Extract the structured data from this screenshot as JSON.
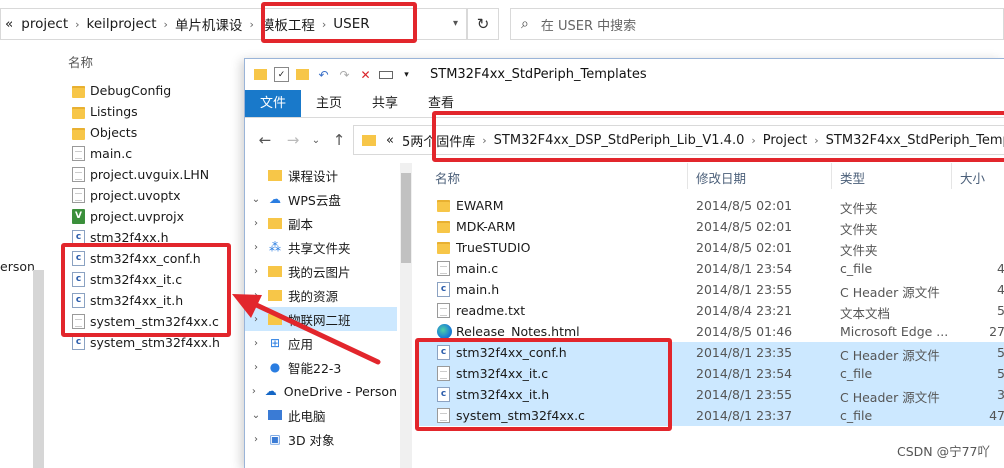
{
  "bg": {
    "address": {
      "prefix": "«",
      "crumbs": [
        "project",
        "keilproject",
        "单片机课设",
        "模板工程",
        "USER"
      ],
      "dropdown_icon": "chevron-down-icon"
    },
    "refresh_icon": "refresh-icon",
    "search": {
      "placeholder": "在 USER 中搜索",
      "icon": "search-icon"
    },
    "left_partial_text": "erson",
    "column_header": "名称",
    "files": [
      {
        "name": "DebugConfig",
        "icon": "folder"
      },
      {
        "name": "Listings",
        "icon": "folder"
      },
      {
        "name": "Objects",
        "icon": "folder"
      },
      {
        "name": "main.c",
        "icon": "file"
      },
      {
        "name": "project.uvguix.LHN",
        "icon": "file"
      },
      {
        "name": "project.uvoptx",
        "icon": "file"
      },
      {
        "name": "project.uvprojx",
        "icon": "uvproj"
      },
      {
        "name": "stm32f4xx.h",
        "icon": "c"
      },
      {
        "name": "stm32f4xx_conf.h",
        "icon": "c"
      },
      {
        "name": "stm32f4xx_it.c",
        "icon": "c"
      },
      {
        "name": "stm32f4xx_it.h",
        "icon": "c"
      },
      {
        "name": "system_stm32f4xx.c",
        "icon": "file"
      },
      {
        "name": "system_stm32f4xx.h",
        "icon": "c"
      }
    ],
    "partial_headers": [
      "修改日期",
      "类型",
      "大小"
    ]
  },
  "fg": {
    "title": "STM32F4xx_StdPeriph_Templates",
    "ribbon_tabs": [
      "文件",
      "主页",
      "共享",
      "查看"
    ],
    "address": {
      "prefix": "«",
      "crumbs": [
        "5两个固件库",
        "STM32F4xx_DSP_StdPeriph_Lib_V1.4.0",
        "Project",
        "STM32F4xx_StdPeriph_Templates"
      ]
    },
    "nav_pane": [
      {
        "label": "课程设计",
        "icon": "folder",
        "arrow": ""
      },
      {
        "label": "WPS云盘",
        "icon": "cloud-icon",
        "arrow": "⌄"
      },
      {
        "label": "副本",
        "icon": "folder",
        "arrow": "›"
      },
      {
        "label": "共享文件夹",
        "icon": "share-icon",
        "arrow": "›"
      },
      {
        "label": "我的云图片",
        "icon": "folder",
        "arrow": "›"
      },
      {
        "label": "我的资源",
        "icon": "folder",
        "arrow": "›"
      },
      {
        "label": "物联网二班",
        "icon": "folder",
        "arrow": "›",
        "selected": true
      },
      {
        "label": "应用",
        "icon": "apps-icon",
        "arrow": "›"
      },
      {
        "label": "智能22-3",
        "icon": "group-icon",
        "arrow": "›"
      },
      {
        "label": "OneDrive - Person",
        "icon": "onedrive-icon",
        "arrow": "›"
      },
      {
        "label": "此电脑",
        "icon": "pc-icon",
        "arrow": "⌄"
      },
      {
        "label": "3D 对象",
        "icon": "cube-icon",
        "arrow": "›"
      }
    ],
    "columns": [
      "名称",
      "修改日期",
      "类型",
      "大小"
    ],
    "files": [
      {
        "name": "EWARM",
        "date": "2014/8/5 02:01",
        "type": "文件夹",
        "size": "",
        "icon": "folder"
      },
      {
        "name": "MDK-ARM",
        "date": "2014/8/5 02:01",
        "type": "文件夹",
        "size": "",
        "icon": "folder"
      },
      {
        "name": "TrueSTUDIO",
        "date": "2014/8/5 02:01",
        "type": "文件夹",
        "size": "",
        "icon": "folder"
      },
      {
        "name": "main.c",
        "date": "2014/8/1 23:54",
        "type": "c_file",
        "size": "4",
        "icon": "file"
      },
      {
        "name": "main.h",
        "date": "2014/8/1 23:55",
        "type": "C Header 源文件",
        "size": "4",
        "icon": "c"
      },
      {
        "name": "readme.txt",
        "date": "2014/8/4 23:21",
        "type": "文本文档",
        "size": "5",
        "icon": "file"
      },
      {
        "name": "Release_Notes.html",
        "date": "2014/8/5 01:46",
        "type": "Microsoft Edge ...",
        "size": "27",
        "icon": "edge"
      },
      {
        "name": "stm32f4xx_conf.h",
        "date": "2014/8/1 23:35",
        "type": "C Header 源文件",
        "size": "5",
        "icon": "c",
        "selected": true
      },
      {
        "name": "stm32f4xx_it.c",
        "date": "2014/8/1 23:54",
        "type": "c_file",
        "size": "5",
        "icon": "file",
        "selected": true
      },
      {
        "name": "stm32f4xx_it.h",
        "date": "2014/8/1 23:55",
        "type": "C Header 源文件",
        "size": "3",
        "icon": "c",
        "selected": true
      },
      {
        "name": "system_stm32f4xx.c",
        "date": "2014/8/1 23:37",
        "type": "c_file",
        "size": "47",
        "icon": "file",
        "selected": true
      }
    ]
  },
  "watermark": "CSDN @宁77吖",
  "colors": {
    "annotation_red": "#e2262c",
    "selection": "#cce8ff",
    "ribbon_active": "#1979ca"
  }
}
